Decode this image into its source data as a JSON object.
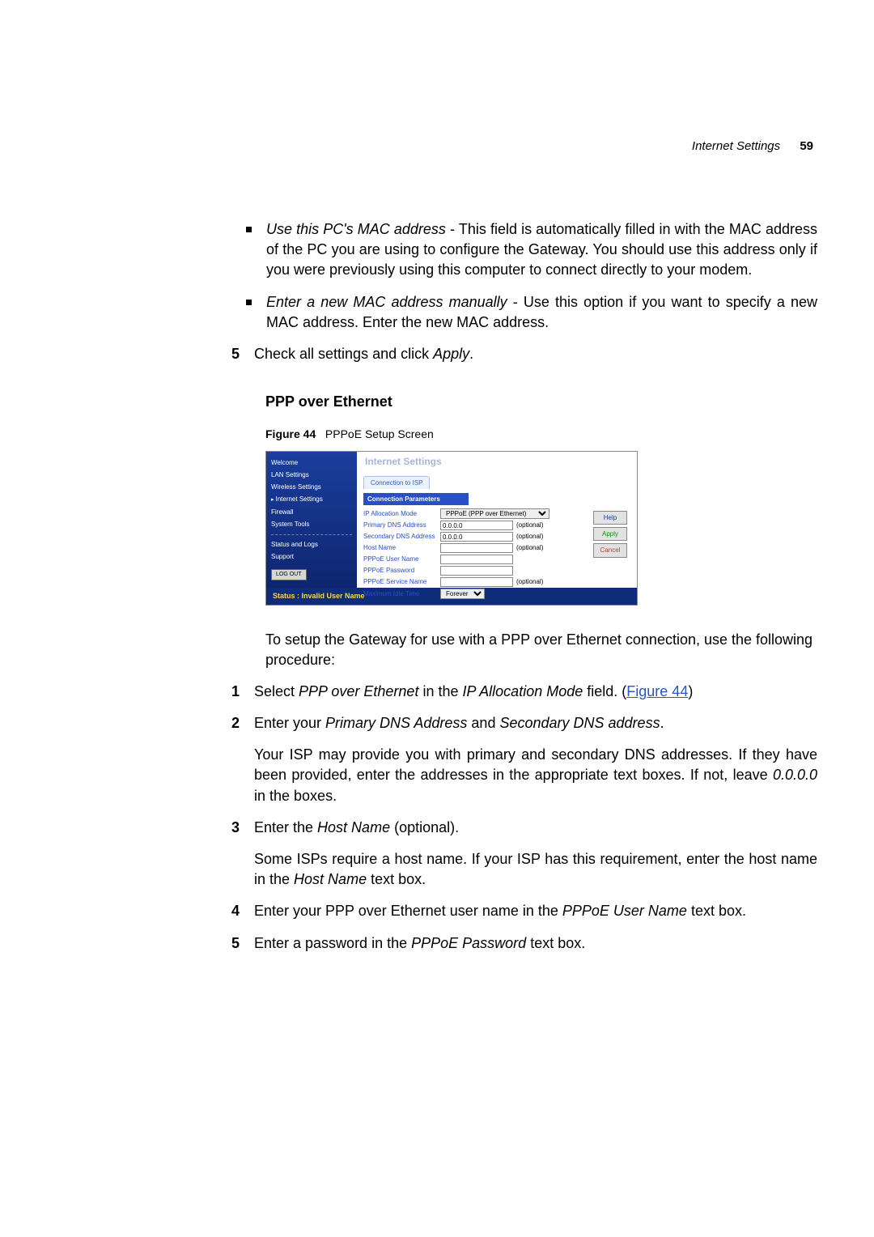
{
  "header": {
    "section_title": "Internet Settings",
    "page_number": "59"
  },
  "bullets": [
    {
      "lead_italic": "Use this PC's MAC address",
      "rest": " - This field is automatically filled in with the MAC address of the PC you are using to configure the Gateway. You should use this address only if you were previously using this computer to connect directly to your modem."
    },
    {
      "lead_italic": "Enter a new MAC address manually",
      "rest": " - Use this option if you want to specify a new MAC address. Enter the new MAC address."
    }
  ],
  "step5_top": {
    "num": "5",
    "prefix": "Check all settings and click ",
    "italic": "Apply",
    "suffix": "."
  },
  "section_heading": "PPP over Ethernet",
  "figure": {
    "label": "Figure 44",
    "caption": "PPPoE Setup Screen",
    "title": "Internet Settings",
    "tab": "Connection to ISP",
    "sidebar": {
      "items": [
        "Welcome",
        "LAN Settings",
        "Wireless Settings",
        "Internet Settings",
        "Firewall",
        "System Tools"
      ],
      "items2": [
        "Status and Logs",
        "Support"
      ],
      "logout": "LOG OUT"
    },
    "fieldset_label": "Connection Parameters",
    "rows": {
      "ip_mode_label": "IP Allocation Mode",
      "ip_mode_value": "PPPoE (PPP over Ethernet)",
      "pdns_label": "Primary DNS Address",
      "pdns_value": "0.0.0.0",
      "sdns_label": "Secondary DNS Address",
      "sdns_value": "0.0.0.0",
      "host_label": "Host Name",
      "user_label": "PPPoE User Name",
      "pass_label": "PPPoE Password",
      "svc_label": "PPPoE Service Name",
      "idle_label": "Maximum Idle Time",
      "idle_value": "Forever",
      "optional": "(optional)"
    },
    "buttons": {
      "help": "Help",
      "apply": "Apply",
      "cancel": "Cancel"
    },
    "status": "Status : Invalid User Name"
  },
  "after_figure_para": "To setup the Gateway for use with a PPP over Ethernet connection, use the following procedure:",
  "steps": [
    {
      "num": "1",
      "parts": [
        "Select ",
        "PPP over Ethernet",
        " in the ",
        "IP Allocation Mode",
        " field. (",
        "Figure 44",
        ")"
      ]
    },
    {
      "num": "2",
      "parts": [
        "Enter your ",
        "Primary DNS Address",
        " and ",
        "Secondary DNS address",
        "."
      ]
    }
  ],
  "step2_para": {
    "prefix": "Your ISP may provide you with primary and secondary DNS addresses. If they have been provided, enter the addresses in the appropriate text boxes. If not, leave ",
    "italic": "0.0.0.0",
    "suffix": " in the boxes."
  },
  "step3": {
    "num": "3",
    "prefix": "Enter the ",
    "italic": "Host Name",
    "suffix": " (optional)."
  },
  "step3_para": {
    "prefix": "Some ISPs require a host name. If your ISP has this requirement, enter the host name in the ",
    "italic": "Host Name",
    "suffix": " text box."
  },
  "step4": {
    "num": "4",
    "prefix": "Enter your PPP over Ethernet user name in the ",
    "italic": "PPPoE User Name",
    "suffix": " text box."
  },
  "step5": {
    "num": "5",
    "prefix": "Enter a password in the ",
    "italic": "PPPoE Password",
    "suffix": " text box."
  }
}
